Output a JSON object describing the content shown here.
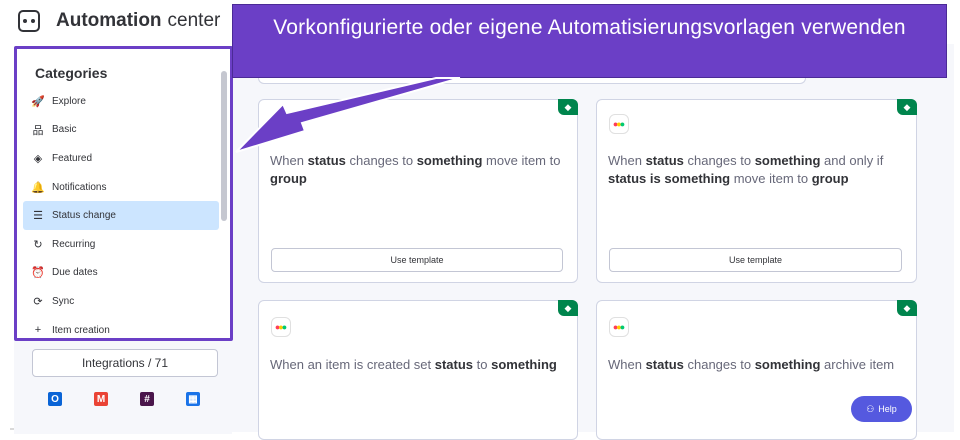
{
  "header": {
    "title_strong": "Automation",
    "title_light": "center",
    "icon": "robot-icon"
  },
  "callout": {
    "text": "Vorkonfigurierte oder eigene Automatisierungsvorlagen verwenden",
    "color": "#6b3fc6"
  },
  "sidebar": {
    "categories_title": "Categories",
    "items": [
      {
        "label": "Explore",
        "icon": "rocket-icon",
        "glyph": "🚀",
        "active": false
      },
      {
        "label": "Basic",
        "icon": "hierarchy-icon",
        "glyph": "品",
        "active": false
      },
      {
        "label": "Featured",
        "icon": "diamond-icon",
        "glyph": "◈",
        "active": false
      },
      {
        "label": "Notifications",
        "icon": "bell-icon",
        "glyph": "🔔",
        "active": false
      },
      {
        "label": "Status change",
        "icon": "list-icon",
        "glyph": "☰",
        "active": true
      },
      {
        "label": "Recurring",
        "icon": "recurring-icon",
        "glyph": "↻",
        "active": false
      },
      {
        "label": "Due dates",
        "icon": "alarm-clock-icon",
        "glyph": "⏰",
        "active": false
      },
      {
        "label": "Sync",
        "icon": "sync-icon",
        "glyph": "⟳",
        "active": false
      },
      {
        "label": "Item creation",
        "icon": "plus-icon",
        "glyph": "+",
        "active": false
      }
    ],
    "integrations_label": "Integrations / 71",
    "integration_icons": [
      {
        "name": "outlook-icon",
        "glyph": "O",
        "color": "#0a64d6"
      },
      {
        "name": "gmail-icon",
        "glyph": "M",
        "color": "#ea4335"
      },
      {
        "name": "slack-icon",
        "glyph": "#",
        "color": "#4a154b"
      },
      {
        "name": "google-calendar-icon",
        "glyph": "▦",
        "color": "#1a73e8"
      }
    ]
  },
  "cards": [
    {
      "parts": [
        {
          "t": "When ",
          "b": false
        },
        {
          "t": "status",
          "b": true
        },
        {
          "t": " changes to ",
          "b": false
        },
        {
          "t": "something",
          "b": true
        },
        {
          "t": " move item to ",
          "b": false
        },
        {
          "t": "group",
          "b": true
        }
      ],
      "button": "Use template",
      "has_logo": false
    },
    {
      "parts": [
        {
          "t": "When ",
          "b": false
        },
        {
          "t": "status",
          "b": true
        },
        {
          "t": " changes to ",
          "b": false
        },
        {
          "t": "something",
          "b": true
        },
        {
          "t": " and only if ",
          "b": false
        },
        {
          "t": "status is something",
          "b": true
        },
        {
          "t": " move item to ",
          "b": false
        },
        {
          "t": "group",
          "b": true
        }
      ],
      "button": "Use template",
      "has_logo": true
    },
    {
      "parts": [
        {
          "t": "When an item is created set ",
          "b": false
        },
        {
          "t": "status",
          "b": true
        },
        {
          "t": " to ",
          "b": false
        },
        {
          "t": "something",
          "b": true
        }
      ],
      "has_logo": true
    },
    {
      "parts": [
        {
          "t": "When ",
          "b": false
        },
        {
          "t": "status",
          "b": true
        },
        {
          "t": " changes to ",
          "b": false
        },
        {
          "t": "something",
          "b": true
        },
        {
          "t": " archive item",
          "b": false
        }
      ],
      "has_logo": true
    }
  ],
  "help_label": "Help",
  "colors": {
    "accent_purple": "#6b3fc6",
    "featured_green": "#00854d",
    "active_item": "#cce5ff",
    "help_button": "#5559df"
  }
}
